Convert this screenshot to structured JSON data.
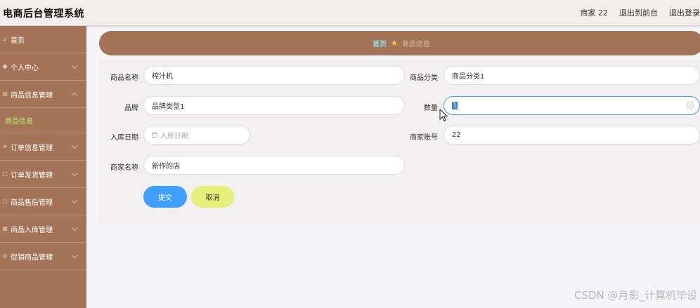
{
  "header": {
    "app_title": "电商后台管理系统",
    "user": "商家 22",
    "exit_front": "退出到前台",
    "logout": "退出登录"
  },
  "sidebar": {
    "items": [
      {
        "label": "首页",
        "icon": "home-icon",
        "expandable": false
      },
      {
        "label": "个人中心",
        "icon": "user-icon",
        "expandable": true,
        "expanded": false
      },
      {
        "label": "商品信息管理",
        "icon": "goods-icon",
        "expandable": true,
        "expanded": true
      },
      {
        "label": "订单信息管理",
        "icon": "order-icon",
        "expandable": true,
        "expanded": false
      },
      {
        "label": "订单发货管理",
        "icon": "shipping-icon",
        "expandable": true,
        "expanded": false
      },
      {
        "label": "商品售后管理",
        "icon": "aftersale-icon",
        "expandable": true,
        "expanded": false
      },
      {
        "label": "商品入库管理",
        "icon": "warehouse-icon",
        "expandable": true,
        "expanded": false
      },
      {
        "label": "促销商品管理",
        "icon": "promo-icon",
        "expandable": true,
        "expanded": false
      }
    ],
    "active_sub_item": "商品信息"
  },
  "breadcrumb": {
    "home": "首页",
    "current": "商品信息"
  },
  "form": {
    "product_name_label": "商品名称",
    "product_name_value": "榨汁机",
    "category_label": "商品分类",
    "category_value": "商品分类1",
    "brand_label": "品牌",
    "brand_value": "品牌类型1",
    "quantity_label": "数量",
    "quantity_value": "1",
    "date_label": "入库日期",
    "date_placeholder": "入库日期",
    "merchant_account_label": "商家账号",
    "merchant_account_value": "22",
    "merchant_name_label": "商家名称",
    "merchant_name_value": "新作的店",
    "submit_label": "提交",
    "cancel_label": "取消"
  },
  "watermark": "CSDN @月影_计算机毕设",
  "colors": {
    "sidebar_bg": "#a47358",
    "active_sub": "#b9f06a",
    "primary": "#409eff",
    "cancel": "#e6ef7a",
    "breadcrumb_home": "#89e1e9"
  }
}
